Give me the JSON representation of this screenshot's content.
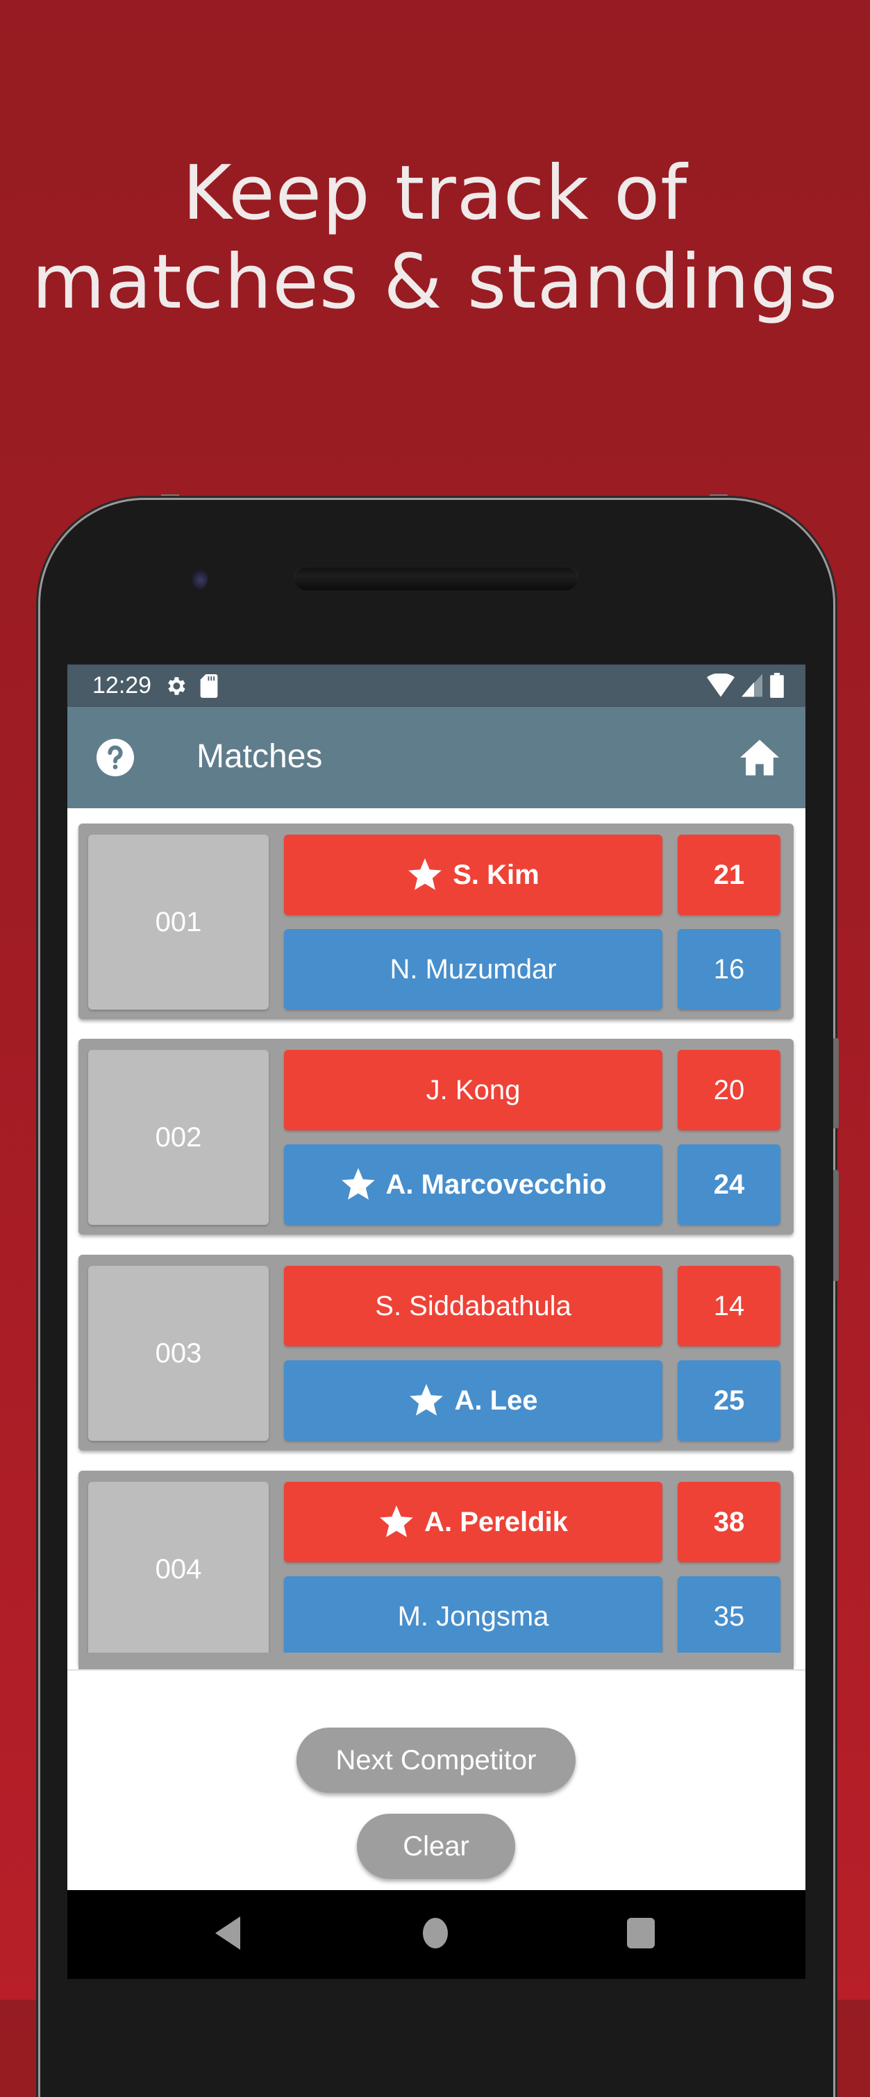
{
  "headline": {
    "line1": "Keep track of",
    "line2": "matches & standings"
  },
  "colors": {
    "background": "#a01c24",
    "status_bar": "#485b66",
    "app_bar": "#607d8c",
    "red_competitor": "#ee4237",
    "blue_competitor": "#478ecc",
    "match_card": "#9e9e9e",
    "match_number": "#bdbdbd",
    "button": "#9e9e9e"
  },
  "status_bar": {
    "time": "12:29",
    "left_icons": [
      "gear-icon",
      "sd-card-icon"
    ],
    "right_icons": [
      "wifi-icon",
      "cell-signal-icon",
      "battery-icon"
    ]
  },
  "app_bar": {
    "title": "Matches",
    "left_icon": "help-icon",
    "right_icon": "home-icon"
  },
  "matches": [
    {
      "number": "001",
      "red": {
        "name": "S. Kim",
        "score": "21",
        "winner": true
      },
      "blue": {
        "name": "N. Muzumdar",
        "score": "16",
        "winner": false
      }
    },
    {
      "number": "002",
      "red": {
        "name": "J. Kong",
        "score": "20",
        "winner": false
      },
      "blue": {
        "name": "A. Marcovecchio",
        "score": "24",
        "winner": true
      }
    },
    {
      "number": "003",
      "red": {
        "name": "S. Siddabathula",
        "score": "14",
        "winner": false
      },
      "blue": {
        "name": "A. Lee",
        "score": "25",
        "winner": true
      }
    },
    {
      "number": "004",
      "red": {
        "name": "A. Pereldik",
        "score": "38",
        "winner": true
      },
      "blue": {
        "name": "M. Jongsma",
        "score": "35",
        "winner": false
      }
    }
  ],
  "actions": {
    "next_competitor": "Next Competitor",
    "clear": "Clear"
  },
  "nav_bar": {
    "back": "back-icon",
    "home": "home-circle-icon",
    "recents": "recents-icon"
  }
}
